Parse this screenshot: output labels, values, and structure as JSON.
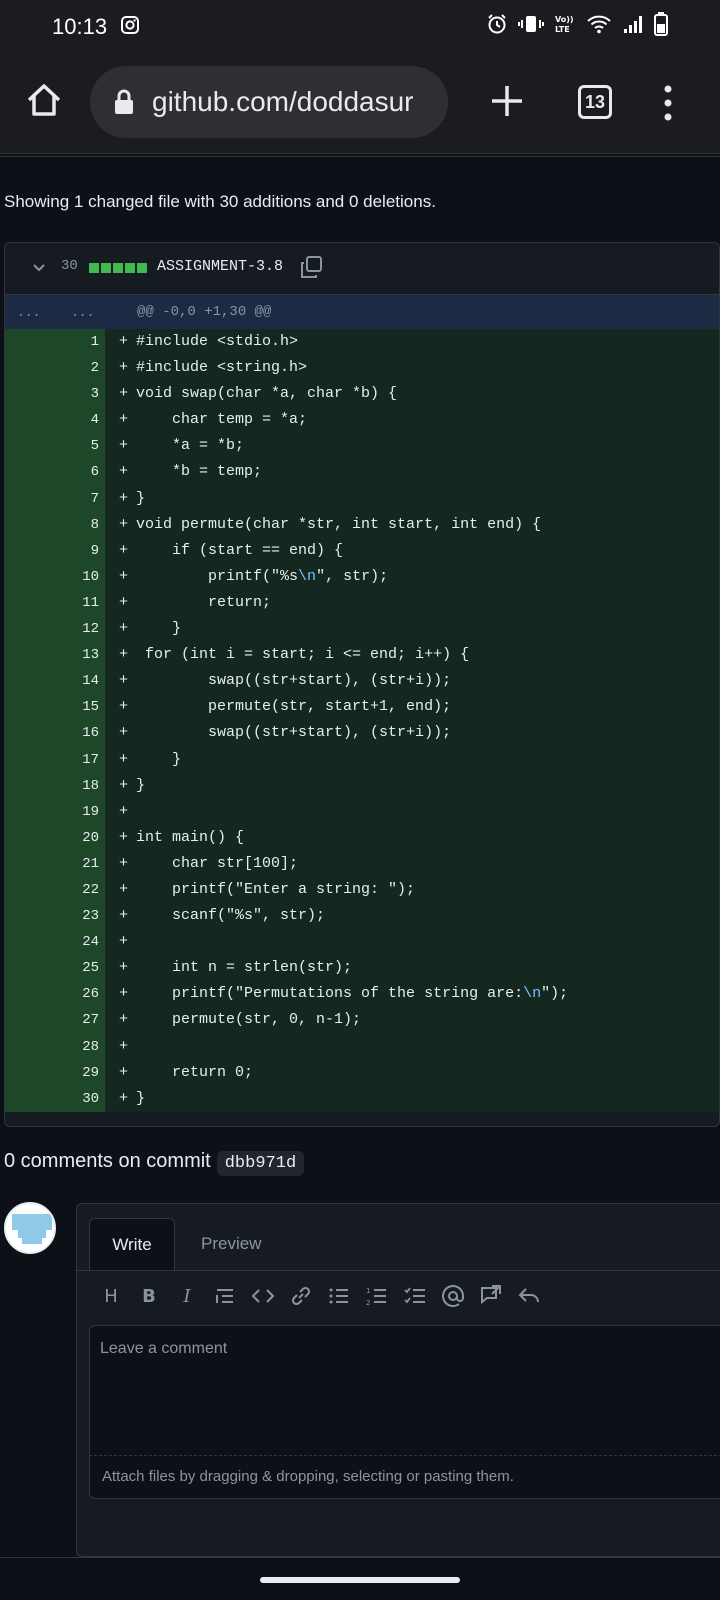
{
  "status": {
    "time": "10:13",
    "icons": [
      "instagram-icon",
      "alarm-icon",
      "vibrate-icon",
      "volte-icon",
      "wifi-icon",
      "signal-icon",
      "battery-icon"
    ]
  },
  "browser": {
    "url": "github.com/doddasur",
    "tab_count": "13"
  },
  "summary": "Showing 1 changed file with 30 additions and 0 deletions.",
  "file": {
    "changes": "30",
    "name": "ASSIGNMENT-3.8",
    "hunk_left": "...",
    "hunk_right": "...",
    "hunk_header": "@@ -0,0 +1,30 @@"
  },
  "code_lines": [
    {
      "n": "1",
      "text": "#include <stdio.h>"
    },
    {
      "n": "2",
      "text": "#include <string.h>"
    },
    {
      "n": "3",
      "text": "void swap(char *a, char *b) {"
    },
    {
      "n": "4",
      "text": "    char temp = *a;"
    },
    {
      "n": "5",
      "text": "    *a = *b;"
    },
    {
      "n": "6",
      "text": "    *b = temp;"
    },
    {
      "n": "7",
      "text": "}"
    },
    {
      "n": "8",
      "text": "void permute(char *str, int start, int end) {"
    },
    {
      "n": "9",
      "text": "    if (start == end) {"
    },
    {
      "n": "10",
      "text": "        printf(\"%s\\n\", str);"
    },
    {
      "n": "11",
      "text": "        return;"
    },
    {
      "n": "12",
      "text": "    }"
    },
    {
      "n": "13",
      "text": " for (int i = start; i <= end; i++) {"
    },
    {
      "n": "14",
      "text": "        swap((str+start), (str+i));"
    },
    {
      "n": "15",
      "text": "        permute(str, start+1, end);"
    },
    {
      "n": "16",
      "text": "        swap((str+start), (str+i));"
    },
    {
      "n": "17",
      "text": "    }"
    },
    {
      "n": "18",
      "text": "}"
    },
    {
      "n": "19",
      "text": ""
    },
    {
      "n": "20",
      "text": "int main() {"
    },
    {
      "n": "21",
      "text": "    char str[100];"
    },
    {
      "n": "22",
      "text": "    printf(\"Enter a string: \");"
    },
    {
      "n": "23",
      "text": "    scanf(\"%s\", str);"
    },
    {
      "n": "24",
      "text": ""
    },
    {
      "n": "25",
      "text": "    int n = strlen(str);"
    },
    {
      "n": "26",
      "text": "    printf(\"Permutations of the string are:\\n\");"
    },
    {
      "n": "27",
      "text": "    permute(str, 0, n-1);"
    },
    {
      "n": "28",
      "text": ""
    },
    {
      "n": "29",
      "text": "    return 0;"
    },
    {
      "n": "30",
      "text": "}"
    }
  ],
  "comments": {
    "title": "0 comments on commit",
    "sha": "dbb971d",
    "tab_write": "Write",
    "tab_preview": "Preview",
    "placeholder": "Leave a comment",
    "attach": "Attach files by dragging & dropping, selecting or pasting them.",
    "toolbar": [
      "heading-icon",
      "bold-icon",
      "italic-icon",
      "quote-icon",
      "code-icon",
      "link-icon",
      "bulleted-list-icon",
      "numbered-list-icon",
      "task-list-icon",
      "mention-icon",
      "cross-reference-icon",
      "reply-icon"
    ]
  },
  "colors": {
    "background": "#0d1117",
    "addition_line": "#152820",
    "addition_gutter": "#1e4628",
    "hunk_bg": "#1c2a43",
    "diffstat_green": "#3fb950",
    "escape_blue": "#79c0ff"
  }
}
